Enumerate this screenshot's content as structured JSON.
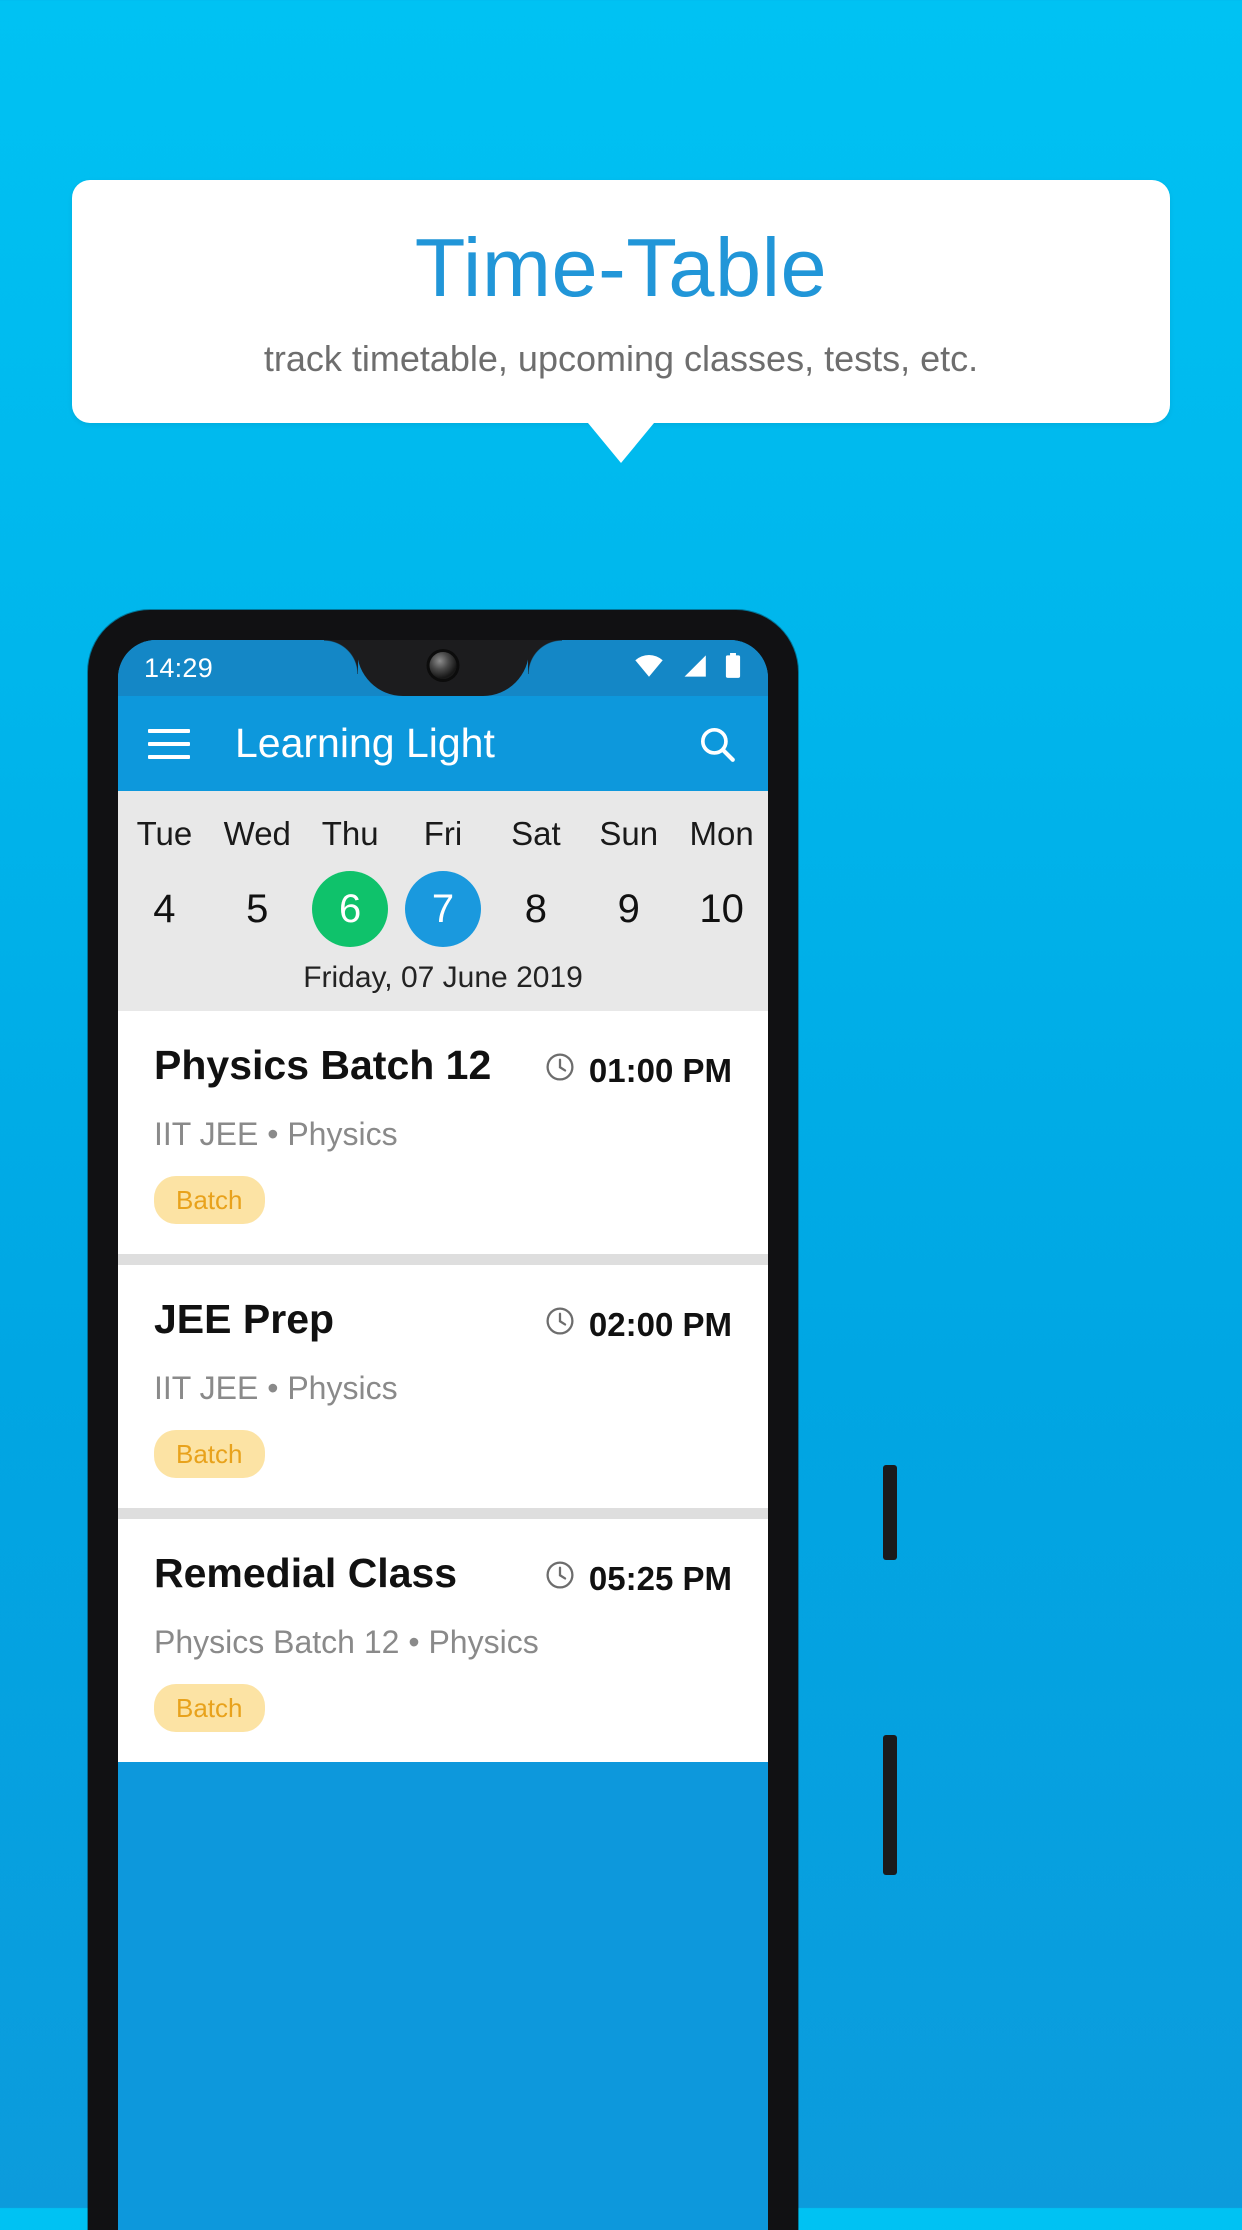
{
  "promo": {
    "title": "Time-Table",
    "subtitle": "track timetable, upcoming classes, tests, etc.",
    "title_color": "#2196D8",
    "subtitle_color": "#6E6E6E",
    "background_color": "#00B6EC"
  },
  "statusbar": {
    "time": "14:29",
    "icons": [
      "wifi-icon",
      "signal-icon",
      "battery-icon"
    ],
    "background_color": "#1487C6"
  },
  "appbar": {
    "menu_icon": "hamburger-menu-icon",
    "title": "Learning Light",
    "search_icon": "search-icon",
    "background_color": "#0D98DC"
  },
  "calendar": {
    "days": [
      {
        "dow": "Tue",
        "num": "4",
        "state": "normal"
      },
      {
        "dow": "Wed",
        "num": "5",
        "state": "normal"
      },
      {
        "dow": "Thu",
        "num": "6",
        "state": "today"
      },
      {
        "dow": "Fri",
        "num": "7",
        "state": "selected"
      },
      {
        "dow": "Sat",
        "num": "8",
        "state": "normal"
      },
      {
        "dow": "Sun",
        "num": "9",
        "state": "normal"
      },
      {
        "dow": "Mon",
        "num": "10",
        "state": "normal"
      }
    ],
    "selected_date_label": "Friday, 07 June 2019",
    "today_color": "#0FC26B",
    "selected_color": "#1A99DE",
    "strip_background": "#E8E8E8"
  },
  "schedule": [
    {
      "title": "Physics Batch 12",
      "time": "01:00 PM",
      "time_icon": "clock-icon",
      "subtitle": "IIT JEE • Physics",
      "badge": "Batch"
    },
    {
      "title": "JEE Prep",
      "time": "02:00 PM",
      "time_icon": "clock-icon",
      "subtitle": "IIT JEE • Physics",
      "badge": "Batch"
    },
    {
      "title": "Remedial Class",
      "time": "05:25 PM",
      "time_icon": "clock-icon",
      "subtitle": "Physics Batch 12 • Physics",
      "badge": "Batch"
    }
  ],
  "colors": {
    "badge_background": "#FCE3A4",
    "badge_text": "#E8A21C",
    "card_background": "#FFFFFF",
    "list_background": "#DEDEDE"
  }
}
